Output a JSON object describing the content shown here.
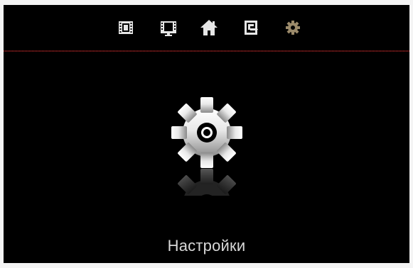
{
  "topbar": {
    "icons": [
      {
        "name": "film-icon",
        "selected": false
      },
      {
        "name": "tv-screen-icon",
        "selected": false
      },
      {
        "name": "home-icon",
        "selected": false
      },
      {
        "name": "switch-source-icon",
        "selected": false
      },
      {
        "name": "settings-gear-icon",
        "selected": true
      }
    ]
  },
  "main": {
    "title": "Настройки",
    "icon": "settings-gear-icon"
  },
  "colors": {
    "background": "#000000",
    "icon": "#e6e6e6",
    "selected_icon": "#9b8a6a",
    "divider": "#7a2020",
    "title_text": "#d8d8d8"
  }
}
